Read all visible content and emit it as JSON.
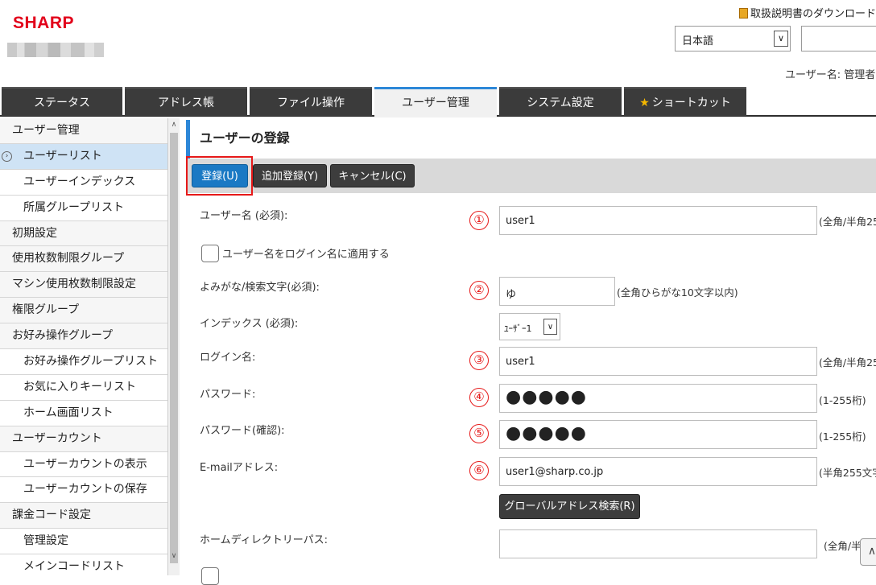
{
  "header": {
    "logo": "SHARP",
    "manual_link": "取扱説明書のダウンロード",
    "language": "日本語",
    "user_label": "ユーザー名: 管理者"
  },
  "tabs": [
    {
      "label": "ステータス"
    },
    {
      "label": "アドレス帳"
    },
    {
      "label": "ファイル操作"
    },
    {
      "label": "ユーザー管理"
    },
    {
      "label": "システム設定"
    },
    {
      "label": "ショートカット"
    }
  ],
  "sidebar": {
    "items": [
      {
        "label": "ユーザー管理"
      },
      {
        "label": "ユーザーリスト"
      },
      {
        "label": "ユーザーインデックス"
      },
      {
        "label": "所属グループリスト"
      },
      {
        "label": "初期設定"
      },
      {
        "label": "使用枚数制限グループ"
      },
      {
        "label": "マシン使用枚数制限設定"
      },
      {
        "label": "権限グループ"
      },
      {
        "label": "お好み操作グループ"
      },
      {
        "label": "お好み操作グループリスト"
      },
      {
        "label": "お気に入りキーリスト"
      },
      {
        "label": "ホーム画面リスト"
      },
      {
        "label": "ユーザーカウント"
      },
      {
        "label": "ユーザーカウントの表示"
      },
      {
        "label": "ユーザーカウントの保存"
      },
      {
        "label": "課金コード設定"
      },
      {
        "label": "管理設定"
      },
      {
        "label": "メインコードリスト"
      }
    ]
  },
  "main": {
    "title": "ユーザーの登録",
    "toolbar": {
      "register": "登録(U)",
      "add_register": "追加登録(Y)",
      "cancel": "キャンセル(C)"
    },
    "form": {
      "username_label": "ユーザー名 (必須):",
      "username_value": "user1",
      "username_hint": "(全角/半角25",
      "apply_login_label": "ユーザー名をログイン名に適用する",
      "yomi_label": "よみがな/検索文字(必須):",
      "yomi_value": "ゆ",
      "yomi_hint": "(全角ひらがな10文字以内)",
      "index_label": "インデックス (必須):",
      "index_value": "ﾕｰｻﾞｰ1",
      "login_label": "ログイン名:",
      "login_value": "user1",
      "login_hint": "(全角/半角25",
      "password_label": "パスワード:",
      "password_value": "●●●●●",
      "password_hint": "(1-255桁)",
      "password_confirm_label": "パスワード(確認):",
      "password_confirm_value": "●●●●●",
      "password_confirm_hint": "(1-255桁)",
      "email_label": "E-mailアドレス:",
      "email_value": "user1@sharp.co.jp",
      "email_hint": "(半角255文字",
      "global_search": "グローバルアドレス検索(R)",
      "home_dir_label": "ホームディレクトリーパス:",
      "home_dir_hint": "(全角/半"
    },
    "markers": [
      "①",
      "②",
      "③",
      "④",
      "⑤",
      "⑥"
    ]
  },
  "colors": {
    "accent": "#2d87d8",
    "primary_button": "#1a79c4",
    "tab_bg": "#3b3b3b",
    "annotation_red": "#e61919",
    "sidebar_active": "#cfe3f5"
  }
}
